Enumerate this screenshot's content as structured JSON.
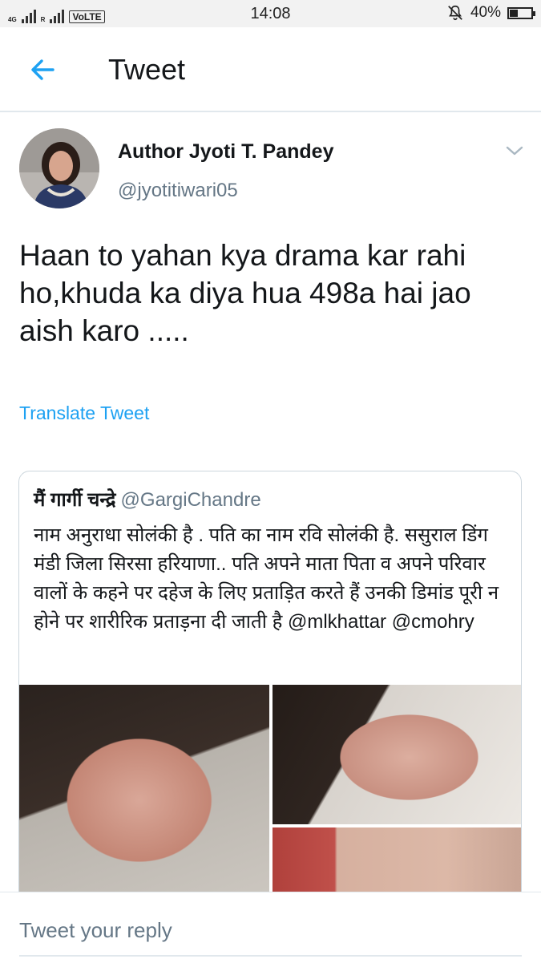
{
  "status_bar": {
    "network_left": "4G",
    "network_right": "R",
    "volte": "VoLTE",
    "time": "14:08",
    "battery": "40%",
    "battery_level": 0.4
  },
  "header": {
    "back_icon": "back-arrow-icon",
    "title": "Tweet"
  },
  "tweet": {
    "author_name": "Author Jyoti T. Pandey",
    "author_handle": "@jyotitiwari05",
    "text": "Haan to yahan kya drama kar rahi ho,khuda ka diya hua 498a hai jao aish karo .....",
    "translate_label": "Translate Tweet"
  },
  "quoted_tweet": {
    "author_name": "मैं गार्गी चन्द्रे",
    "author_handle": "@GargiChandre",
    "text": "नाम अनुराधा सोलंकी है . पति का नाम रवि सोलंकी है. ससुराल डिंग मंडी जिला सिरसा हरियाणा..  पति अपने माता पिता व अपने परिवार वालों के कहने पर दहेज के लिए प्रताड़ित करते हैं उनकी डिमांड पूरी न होने पर शारीरिक प्रताड़ना दी जाती है @mlkhattar @cmohry"
  },
  "reply": {
    "placeholder": "Tweet your reply"
  },
  "colors": {
    "accent": "#1da1f2",
    "muted": "#657786",
    "text": "#14171a",
    "border": "#e1e8ed"
  }
}
